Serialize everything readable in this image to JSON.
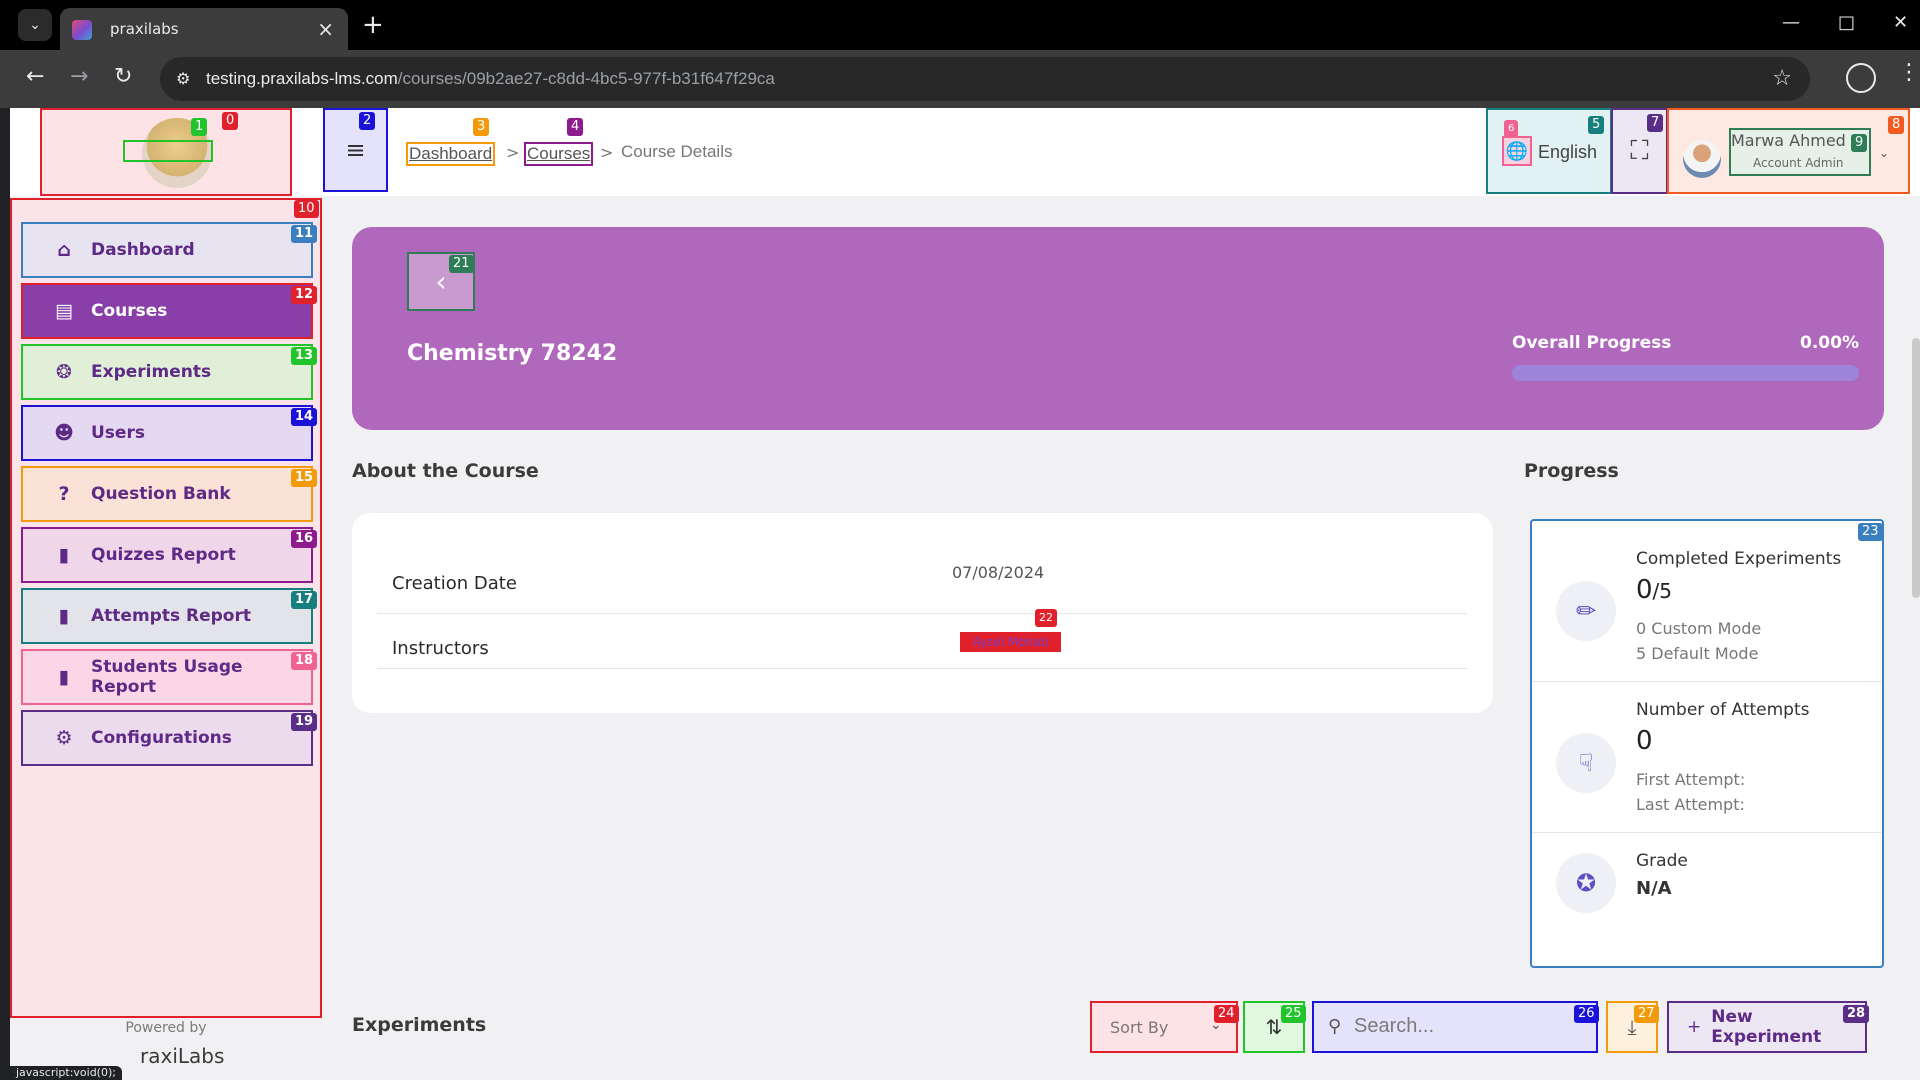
{
  "browser": {
    "tab_title": "praxilabs",
    "url_host": "testing.praxilabs-lms.com",
    "url_path": "/courses/09b2ae27-c8dd-4bc5-977f-b31f647f29ca",
    "status_tip": "javascript:void(0);"
  },
  "header": {
    "breadcrumb": [
      "Dashboard",
      "Courses",
      "Course Details"
    ],
    "breadcrumb_sep": ">",
    "language": "English",
    "user_name": "Marwa Ahmed",
    "user_role": "Account Admin"
  },
  "sidebar": {
    "items": [
      {
        "label": "Dashboard",
        "icon": "home-icon"
      },
      {
        "label": "Courses",
        "icon": "book-icon"
      },
      {
        "label": "Experiments",
        "icon": "aperture-icon"
      },
      {
        "label": "Users",
        "icon": "user-icon"
      },
      {
        "label": "Question Bank",
        "icon": "question-icon"
      },
      {
        "label": "Quizzes Report",
        "icon": "report-icon"
      },
      {
        "label": "Attempts Report",
        "icon": "report-icon"
      },
      {
        "label": "Students Usage Report",
        "icon": "report-icon"
      },
      {
        "label": "Configurations",
        "icon": "gear-icon"
      }
    ],
    "powered_by": "Powered by",
    "brand": "raxiLabs"
  },
  "hero": {
    "course_name": "Chemistry 78242",
    "overall_progress_label": "Overall Progress",
    "overall_progress_value": "0.00%",
    "overall_progress_fraction": 0.0
  },
  "about": {
    "title": "About the Course",
    "creation_date_label": "Creation Date",
    "creation_date": "07/08/2024",
    "instructors_label": "Instructors",
    "instructor": "Aysel Mohab"
  },
  "progress": {
    "title": "Progress",
    "completed_label": "Completed Experiments",
    "completed_num": "0",
    "completed_total": "/5",
    "custom_mode": "0 Custom Mode",
    "default_mode": "5 Default Mode",
    "attempts_label": "Number of Attempts",
    "attempts_value": "0",
    "first_attempt": "First Attempt:",
    "last_attempt": "Last Attempt:",
    "grade_label": "Grade",
    "grade_value": "N/A"
  },
  "experiments": {
    "title": "Experiments",
    "sort_by": "Sort By",
    "search_placeholder": "Search...",
    "new_experiment": "New Experiment"
  },
  "badges": [
    "0",
    "1",
    "2",
    "3",
    "4",
    "5",
    "6",
    "7",
    "8",
    "9",
    "10",
    "11",
    "12",
    "13",
    "14",
    "15",
    "16",
    "17",
    "18",
    "19",
    "21",
    "22",
    "23",
    "24",
    "25",
    "26",
    "27",
    "28"
  ],
  "colors": {
    "hero": "#b068bc",
    "accent": "#5e2a86",
    "active_nav": "#8a3ea8"
  }
}
